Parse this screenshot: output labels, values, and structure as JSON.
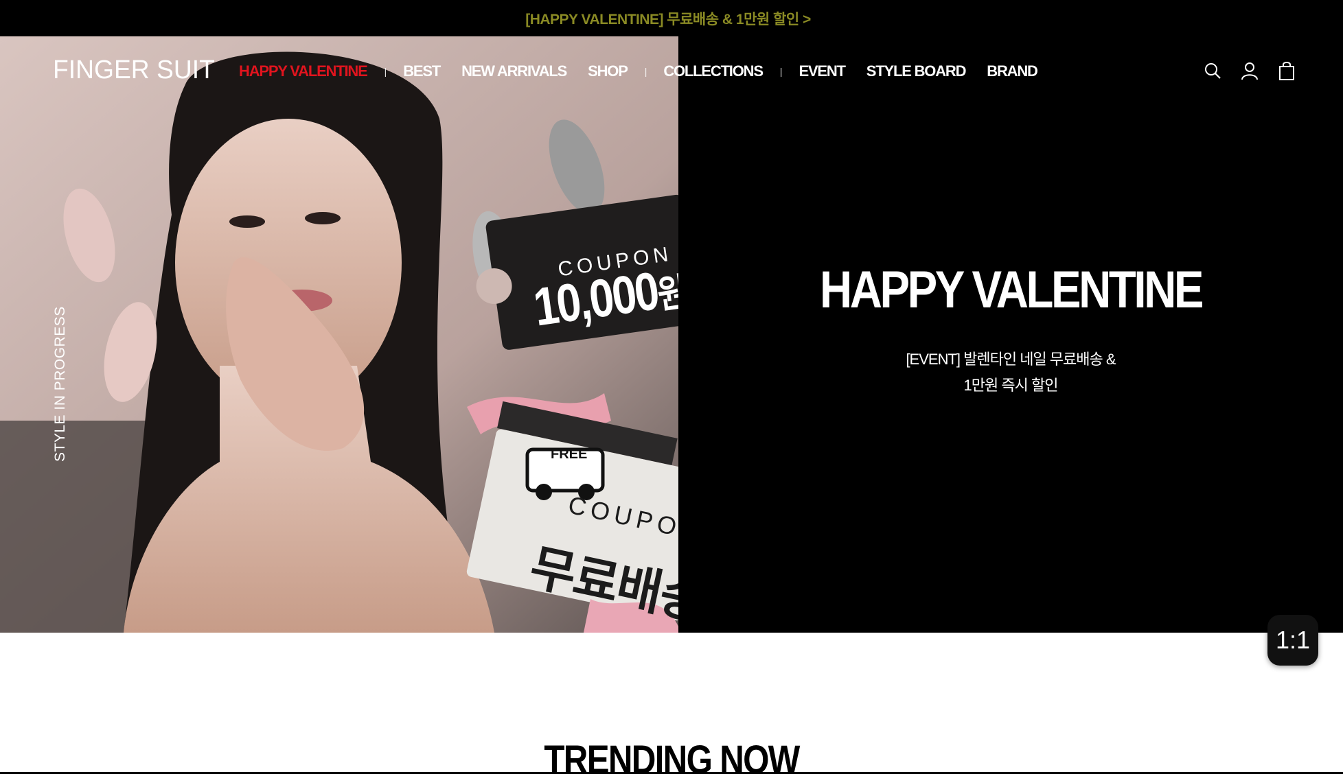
{
  "announcement": {
    "text": "[HAPPY VALENTINE] 무료배송 & 1만원 할인 >"
  },
  "header": {
    "logo": "FINGER SUIT",
    "nav": [
      {
        "label": "HAPPY VALENTINE",
        "active": true
      },
      {
        "label": "BEST"
      },
      {
        "label": "NEW ARRIVALS"
      },
      {
        "label": "SHOP"
      },
      {
        "label": "COLLECTIONS"
      },
      {
        "label": "EVENT"
      },
      {
        "label": "STYLE BOARD"
      },
      {
        "label": "BRAND"
      }
    ],
    "icons": [
      "search-icon",
      "user-icon",
      "cart-icon"
    ]
  },
  "hero": {
    "side_text": "STYLE IN PROGRESS",
    "coupon1_label": "COUPON",
    "coupon1_value": "10,000",
    "coupon1_unit": "원",
    "free_label": "FREE",
    "coupon2_label": "COUPON",
    "coupon2_value": "무료배송",
    "title": "HAPPY VALENTINE",
    "subtitle_line1": "[EVENT] 발렌타인 네일 무료배송 &",
    "subtitle_line2": "1만원 즉시 할인"
  },
  "ratio_badge": "1:1",
  "trending": {
    "title": "TRENDING NOW"
  },
  "colors": {
    "active_nav": "#e0141e",
    "announcement_text": "#8a8a24",
    "background": "#000000"
  }
}
